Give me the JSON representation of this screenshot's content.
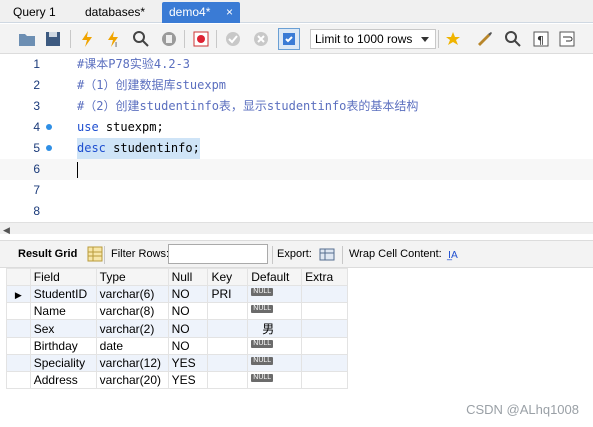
{
  "tabs": [
    {
      "label": "Query 1"
    },
    {
      "label": "databases*"
    },
    {
      "label": "demo4*",
      "close": "×"
    }
  ],
  "toolbar": {
    "limit_select": "Limit to 1000 rows"
  },
  "editor": {
    "lines": [
      {
        "n": "1",
        "text": "#课本P78实验4.2-3"
      },
      {
        "n": "2",
        "text": "#（1）创建数据库stuexpm"
      },
      {
        "n": "3",
        "text": "#（2）创建studentinfo表，显示studentinfo表的基本结构"
      },
      {
        "n": "4",
        "kw": "use",
        "rest": " stuexpm;"
      },
      {
        "n": "5",
        "kw": "desc",
        "rest": " studentinfo;"
      },
      {
        "n": "6",
        "text": ""
      },
      {
        "n": "7",
        "text": ""
      },
      {
        "n": "8",
        "text": ""
      }
    ]
  },
  "result_toolbar": {
    "result_grid": "Result Grid",
    "filter_rows": "Filter Rows:",
    "export": "Export:",
    "wrap": "Wrap Cell Content:"
  },
  "grid": {
    "headers": [
      "Field",
      "Type",
      "Null",
      "Key",
      "Default",
      "Extra"
    ],
    "rows": [
      {
        "field": "StudentID",
        "type": "varchar(6)",
        "null": "NO",
        "key": "PRI",
        "default": "NULL",
        "extra": ""
      },
      {
        "field": "Name",
        "type": "varchar(8)",
        "null": "NO",
        "key": "",
        "default": "NULL",
        "extra": ""
      },
      {
        "field": "Sex",
        "type": "varchar(2)",
        "null": "NO",
        "key": "",
        "default": "男",
        "extra": ""
      },
      {
        "field": "Birthday",
        "type": "date",
        "null": "NO",
        "key": "",
        "default": "NULL",
        "extra": ""
      },
      {
        "field": "Speciality",
        "type": "varchar(12)",
        "null": "YES",
        "key": "",
        "default": "NULL",
        "extra": ""
      },
      {
        "field": "Address",
        "type": "varchar(20)",
        "null": "YES",
        "key": "",
        "default": "NULL",
        "extra": ""
      }
    ]
  },
  "watermark": "CSDN @ALhq1008"
}
